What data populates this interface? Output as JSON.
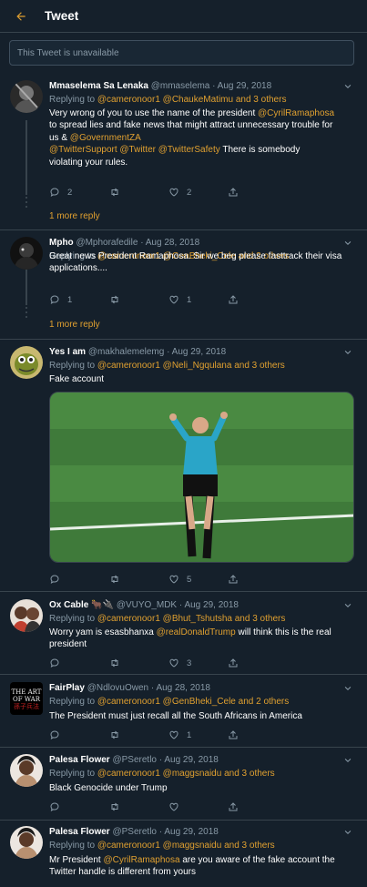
{
  "header": {
    "title": "Tweet"
  },
  "unavailable_text": "This Tweet is unavailable",
  "tweets": [
    {
      "name": "Mmaselema Sa Lenaka",
      "handle": "@mmaselema",
      "date": "· Aug 29, 2018",
      "replying_prefix": "Replying to ",
      "replying": "@cameronoor1 @ChaukeMatimu and 3 others",
      "body_lines": [
        [
          {
            "t": "Very wrong of you to use the name of the president "
          },
          {
            "t": "@CyrilRamaphosa",
            "o": 1
          }
        ],
        [
          {
            "t": "to spread lies and fake news that might attract unnecessary trouble for"
          }
        ],
        [
          {
            "t": "us & "
          },
          {
            "t": "@GovernmentZA",
            "o": 1
          }
        ],
        [
          {
            "t": " "
          }
        ],
        [
          {
            "t": "@TwitterSupport @Twitter @TwitterSafety",
            "o": 1
          },
          {
            "t": "  There is somebody"
          }
        ],
        [
          {
            "t": "violating your rules."
          }
        ]
      ],
      "replies": "2",
      "retweets": "",
      "likes": "2",
      "more_replies": "1 more reply"
    },
    {
      "name": "Mpho",
      "handle": "@Mphorafedile",
      "date": "· Aug 28, 2018",
      "replying_prefix": "Replying to ",
      "replying": "@cameronoor1 @GenBheki_Cele and 2 others",
      "body_lines": [
        [
          {
            "t": "Great news President Ramaphosa. Sir we beg please fasttrack their visa"
          }
        ],
        [
          {
            "t": "applications...."
          }
        ]
      ],
      "replies": "1",
      "retweets": "",
      "likes": "1",
      "more_replies": "1 more reply"
    },
    {
      "name": "Yes I am",
      "handle": "@makhalemelemg",
      "date": "· Aug 29, 2018",
      "replying_prefix": "Replying to ",
      "replying": "@cameronoor1 @Neli_Ngqulana and 3 others",
      "body_lines": [
        [
          {
            "t": "Fake account"
          }
        ]
      ],
      "replies": "",
      "retweets": "",
      "likes": "5"
    },
    {
      "name": "Ox Cable",
      "name_emoji": "🐂🔌",
      "handle": "@VUYO_MDK",
      "date": "· Aug 29, 2018",
      "replying_prefix": "Replying to ",
      "replying": "@cameronoor1 @Bhut_Tshutsha and 3 others",
      "body_lines": [
        [
          {
            "t": "Worry yam is esasbhanxa "
          },
          {
            "t": "@realDonaldTrump",
            "o": 1
          },
          {
            "t": " will think this is the real"
          }
        ],
        [
          {
            "t": "president"
          }
        ]
      ],
      "replies": "",
      "retweets": "",
      "likes": "3"
    },
    {
      "name": "FairPlay",
      "handle": "@NdlovuOwen",
      "date": "· Aug 28, 2018",
      "replying_prefix": "Replying to ",
      "replying": "@cameronoor1 @GenBheki_Cele and 2 others",
      "body_lines": [
        [
          {
            "t": "The President must just recall all the South Africans in America"
          }
        ]
      ],
      "replies": "",
      "retweets": "",
      "likes": "1",
      "avatar_text": "THE ART OF WAR",
      "avatar_sub": "孫子兵法"
    },
    {
      "name": "Palesa Flower",
      "handle": "@PSeretlo",
      "date": "· Aug 29, 2018",
      "replying_prefix": "Replying to ",
      "replying": "@cameronoor1 @maggsnaidu and 3 others",
      "body_lines": [
        [
          {
            "t": "Black Genocide under Trump"
          }
        ]
      ],
      "replies": "",
      "retweets": "",
      "likes": ""
    },
    {
      "name": "Palesa Flower",
      "handle": "@PSeretlo",
      "date": "· Aug 29, 2018",
      "replying_prefix": "Replying to ",
      "replying": "@cameronoor1 @maggsnaidu and 3 others",
      "body_lines": [
        [
          {
            "t": "Mr President "
          },
          {
            "t": "@CyrilRamaphosa",
            "o": 1
          },
          {
            "t": " are you aware of the fake account the"
          }
        ],
        [
          {
            "t": "Twitter handle is different from yours"
          }
        ]
      ],
      "replies": "",
      "retweets": "",
      "likes": ""
    }
  ],
  "colors": {
    "background": "#15202b",
    "accent": "#e0a030",
    "muted": "#8899a6",
    "border": "#38444d"
  }
}
